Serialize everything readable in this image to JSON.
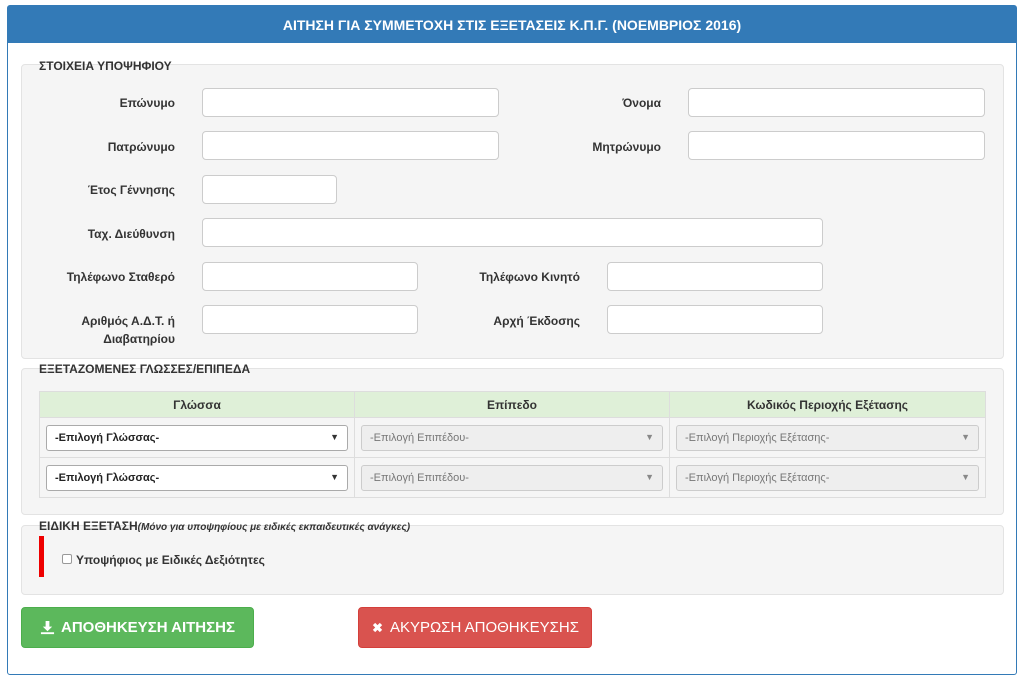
{
  "header": {
    "title": "ΑΙΤΗΣΗ ΓΙΑ ΣΥΜΜΕΤΟΧΗ ΣΤΙΣ ΕΞΕΤΑΣΕΙΣ Κ.Π.Γ. (ΝΟΕΜΒΡΙΟΣ 2016)"
  },
  "candidate": {
    "legend": "ΣΤΟΙΧΕΙΑ ΥΠΟΨΗΦΙΟΥ",
    "surname_label": "Επώνυμο",
    "name_label": "Όνομα",
    "father_label": "Πατρώνυμο",
    "mother_label": "Μητρώνυμο",
    "birth_year_label": "Έτος Γέννησης",
    "address_label": "Ταχ. Διεύθυνση",
    "phone_label": "Τηλέφωνο Σταθερό",
    "mobile_label": "Τηλέφωνο Κινητό",
    "id_label_line1": "Αριθμός Α.Δ.Τ. ή",
    "id_label_line2": "Διαβατηρίου",
    "authority_label": "Αρχή Έκδοσης"
  },
  "languages": {
    "legend": "ΕΞΕΤΑΖΟΜΕΝΕΣ ΓΛΩΣΣΕΣ/ΕΠΙΠΕΔΑ",
    "headers": [
      "Γλώσσα",
      "Επίπεδο",
      "Κωδικός Περιοχής Εξέτασης"
    ],
    "rows": [
      {
        "language": "-Επιλογή Γλώσσας-",
        "level": "-Επιλογή Επιπέδου-",
        "area": "-Επιλογή Περιοχής Εξέτασης-"
      },
      {
        "language": "-Επιλογή Γλώσσας-",
        "level": "-Επιλογή Επιπέδου-",
        "area": "-Επιλογή Περιοχής Εξέτασης-"
      }
    ]
  },
  "special": {
    "legend": "ΕΙΔΙΚΗ ΕΞΕΤΑΣΗ",
    "legend_note": "(Μόνο για υποψηφίους με ειδικές εκπαιδευτικές ανάγκες)",
    "checkbox_label": "Υποψήφιος με Ειδικές Δεξιότητες",
    "checked": false
  },
  "buttons": {
    "save_label": "ΑΠΟΘΗΚΕΥΣΗ ΑΙΤΗΣΗΣ",
    "cancel_label": "ΑΚΥΡΩΣΗ ΑΠΟΘΗΚΕΥΣΗΣ"
  },
  "colors": {
    "primary": "#337ab7",
    "success": "#5cb85c",
    "danger": "#d9534f",
    "table_header": "#dff0d8",
    "marker": "#ee0000"
  },
  "icons": {
    "save": "download-icon",
    "cancel": "times-icon",
    "select": "caret-down-icon"
  }
}
